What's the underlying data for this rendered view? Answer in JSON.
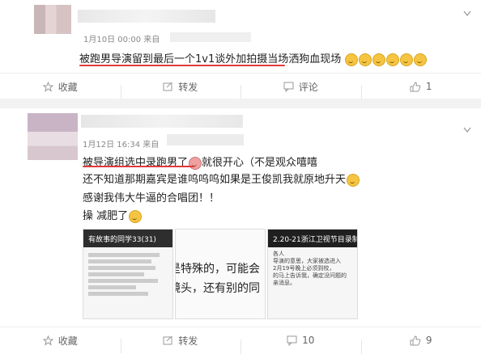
{
  "post1": {
    "meta": "1月10日 00:00 来自",
    "text": "被跑男导演留到最后一个1v1谈外加拍摄当场洒狗血现场"
  },
  "post2": {
    "meta": "1月12日 16:34 来自",
    "line1": "被导演组选中录跑男了",
    "line1b": "就很开心（不是观众嘻嘻",
    "line2": "还不知道那期嘉宾是谁呜呜呜如果是王俊凯我就原地升天",
    "line3": "感谢我伟大牛逼的合唱团！！",
    "line4": "操 减肥了"
  },
  "actions1": {
    "favorite": "收藏",
    "repost": "转发",
    "comment": "评论",
    "like": "1"
  },
  "actions2": {
    "favorite": "收藏",
    "repost": "转发",
    "comment": "10",
    "like": "9"
  },
  "thumbs": {
    "t1_title": "有故事的同学33(31)",
    "t2_text_a": "是特殊的，可能会",
    "t2_text_b": "镜头，还有别的同",
    "t3_title": "2.20-21浙江卫视节目录制",
    "t3_text": "各人\n导演的意思，大家被选进入\n2月19号晚上必须到校，\n的马上告诉我，确定没问题的\n亲消息。"
  }
}
